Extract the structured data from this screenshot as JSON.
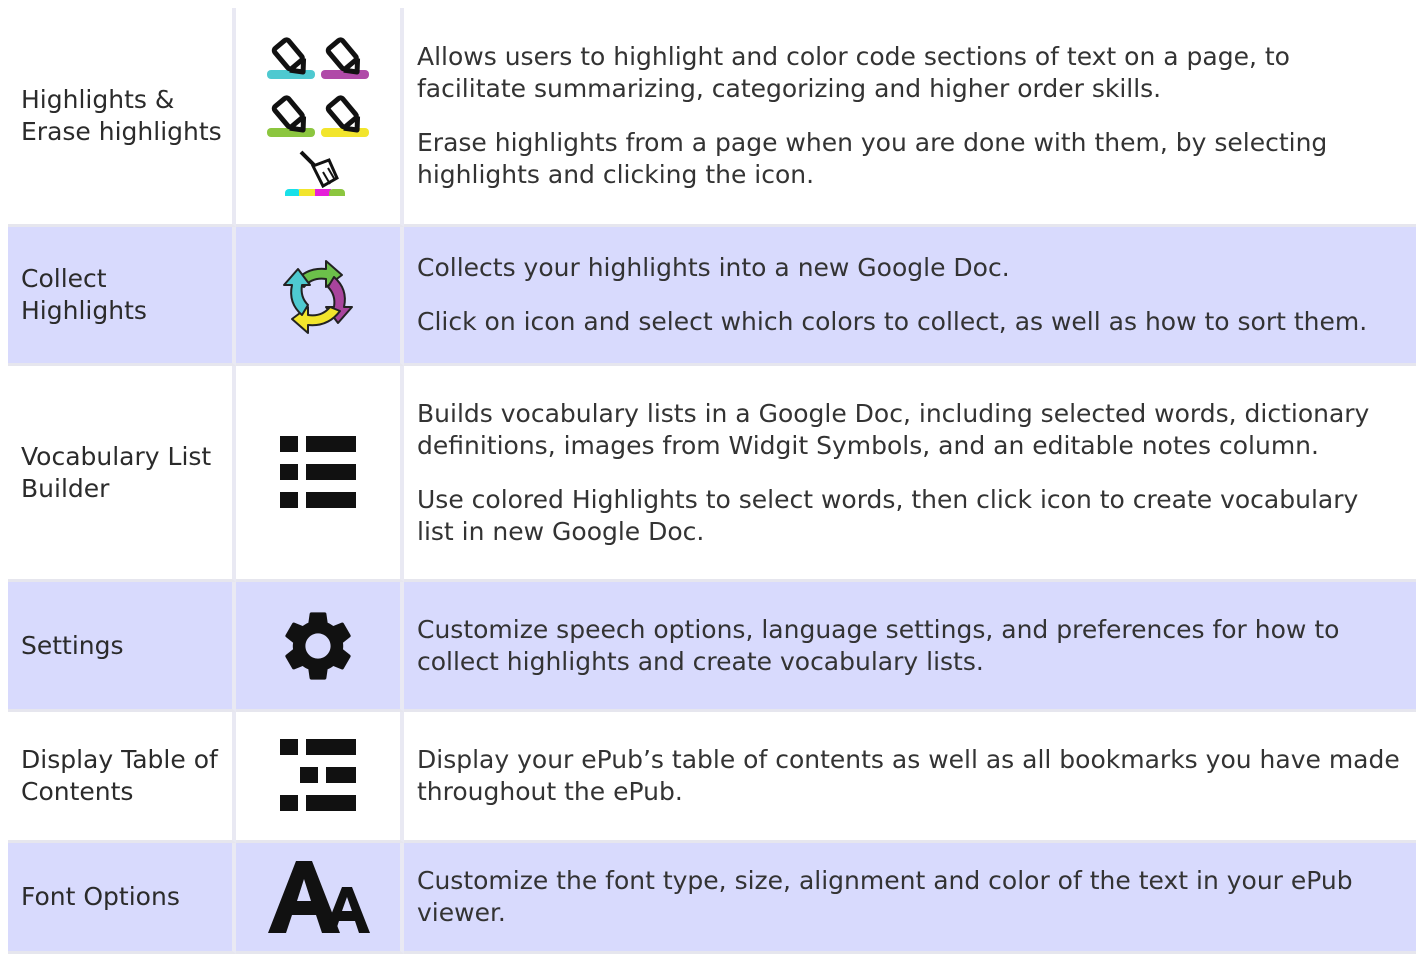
{
  "rows": [
    {
      "name": "Highlights &\nErase highlights",
      "icon": "highlighter-pens-and-eraser-icon",
      "paragraphs": [
        "Allows users to highlight and color code sections of text on a page, to facilitate summarizing, categorizing and higher order skills.",
        "Erase highlights from a page when you are done with them, by selecting highlights and clicking the icon."
      ]
    },
    {
      "name": "Collect\nHighlights",
      "icon": "collect-arrows-icon",
      "paragraphs": [
        "Collects your highlights into a new Google Doc.",
        "Click on icon and select which colors to collect, as well as how to sort them."
      ]
    },
    {
      "name": "Vocabulary List\nBuilder",
      "icon": "list-icon",
      "paragraphs": [
        "Builds vocabulary lists in a Google Doc, including selected words, dictionary definitions, images from Widgit Symbols, and an editable notes column.",
        "Use colored Highlights to select words, then click icon to create vocabulary list in new Google Doc."
      ]
    },
    {
      "name": "Settings",
      "icon": "gear-icon",
      "paragraphs": [
        "Customize speech options, language settings, and preferences for how to collect highlights and create vocabulary lists."
      ]
    },
    {
      "name": "Display Table of\nContents",
      "icon": "table-of-contents-icon",
      "paragraphs": [
        "Display your ePub’s table of contents as well as all bookmarks you have made throughout the ePub."
      ]
    },
    {
      "name": "Font Options",
      "icon": "font-size-icon",
      "paragraphs": [
        "Customize the font type, size, alignment and color of the text in your ePub viewer."
      ]
    }
  ],
  "colors": {
    "row_blue": "#d8dafd",
    "teal": "#4ec9d0",
    "purple": "#b04aa8",
    "green": "#8cc63f",
    "yellow": "#f2e52c",
    "magenta": "#e61fd9",
    "cyan": "#19e0e8"
  }
}
